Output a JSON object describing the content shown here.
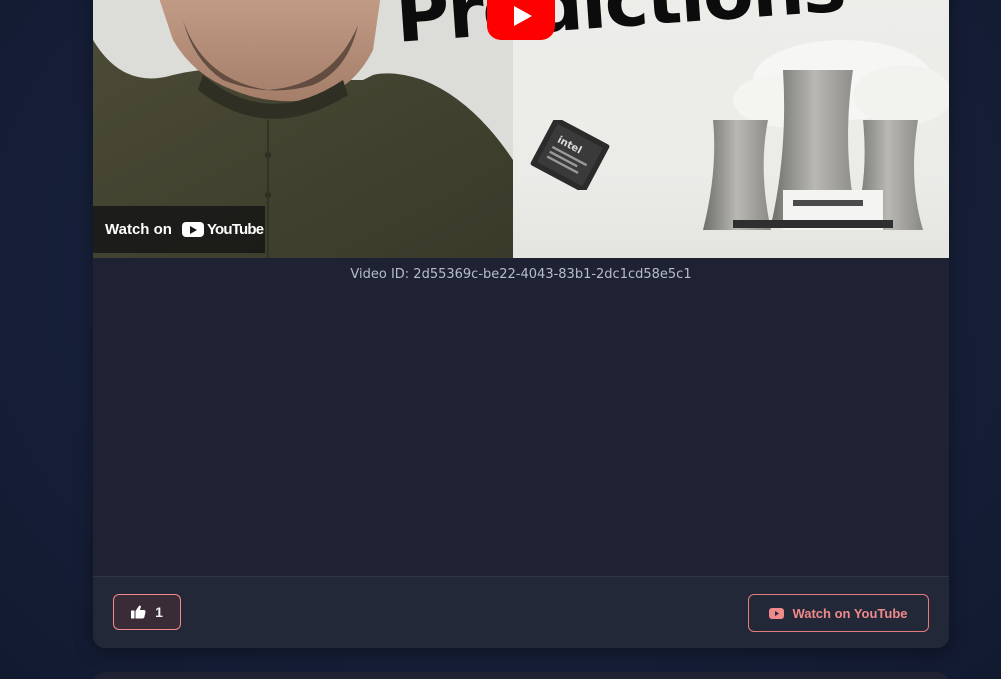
{
  "video": {
    "thumbnail_title": "Predictions",
    "chip_label": "intel",
    "overlay_watch_text": "Watch on",
    "overlay_brand_text": "YouTube",
    "video_id_text": "Video ID: 2d55369c-be22-4043-83b1-2dc1cd58e5c1"
  },
  "footer": {
    "like_count": "1",
    "watch_button_label": "Watch on YouTube"
  },
  "colors": {
    "page_background": "#17203a",
    "card_background": "#1e2232",
    "accent": "#f08a8a",
    "youtube_red": "#ff0000"
  },
  "icons": {
    "like": "thumbs-up-icon",
    "watch": "youtube-icon",
    "play": "play-icon"
  }
}
